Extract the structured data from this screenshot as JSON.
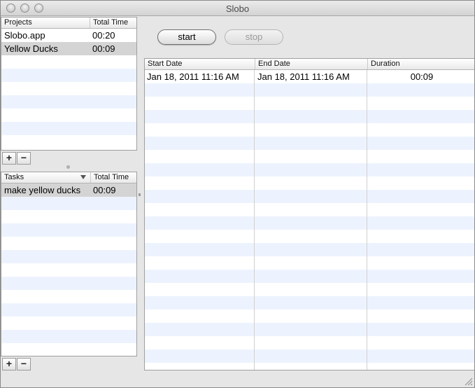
{
  "window": {
    "title": "Slobo"
  },
  "projects": {
    "headers": [
      "Projects",
      "Total Time"
    ],
    "rows": [
      {
        "name": "Slobo.app",
        "time": "00:20"
      },
      {
        "name": "Yellow Ducks",
        "time": "00:09"
      }
    ],
    "add_label": "+",
    "remove_label": "−"
  },
  "tasks": {
    "headers": [
      "Tasks",
      "Total Time"
    ],
    "rows": [
      {
        "name": "make yellow ducks",
        "time": "00:09"
      }
    ],
    "add_label": "+",
    "remove_label": "−"
  },
  "controls": {
    "start_label": "start",
    "stop_label": "stop"
  },
  "entries": {
    "headers": [
      "Start Date",
      "End Date",
      "Duration"
    ],
    "rows": [
      {
        "start": "Jan 18, 2011 11:16 AM",
        "end": "Jan 18, 2011 11:16 AM",
        "duration": "00:09"
      }
    ]
  }
}
